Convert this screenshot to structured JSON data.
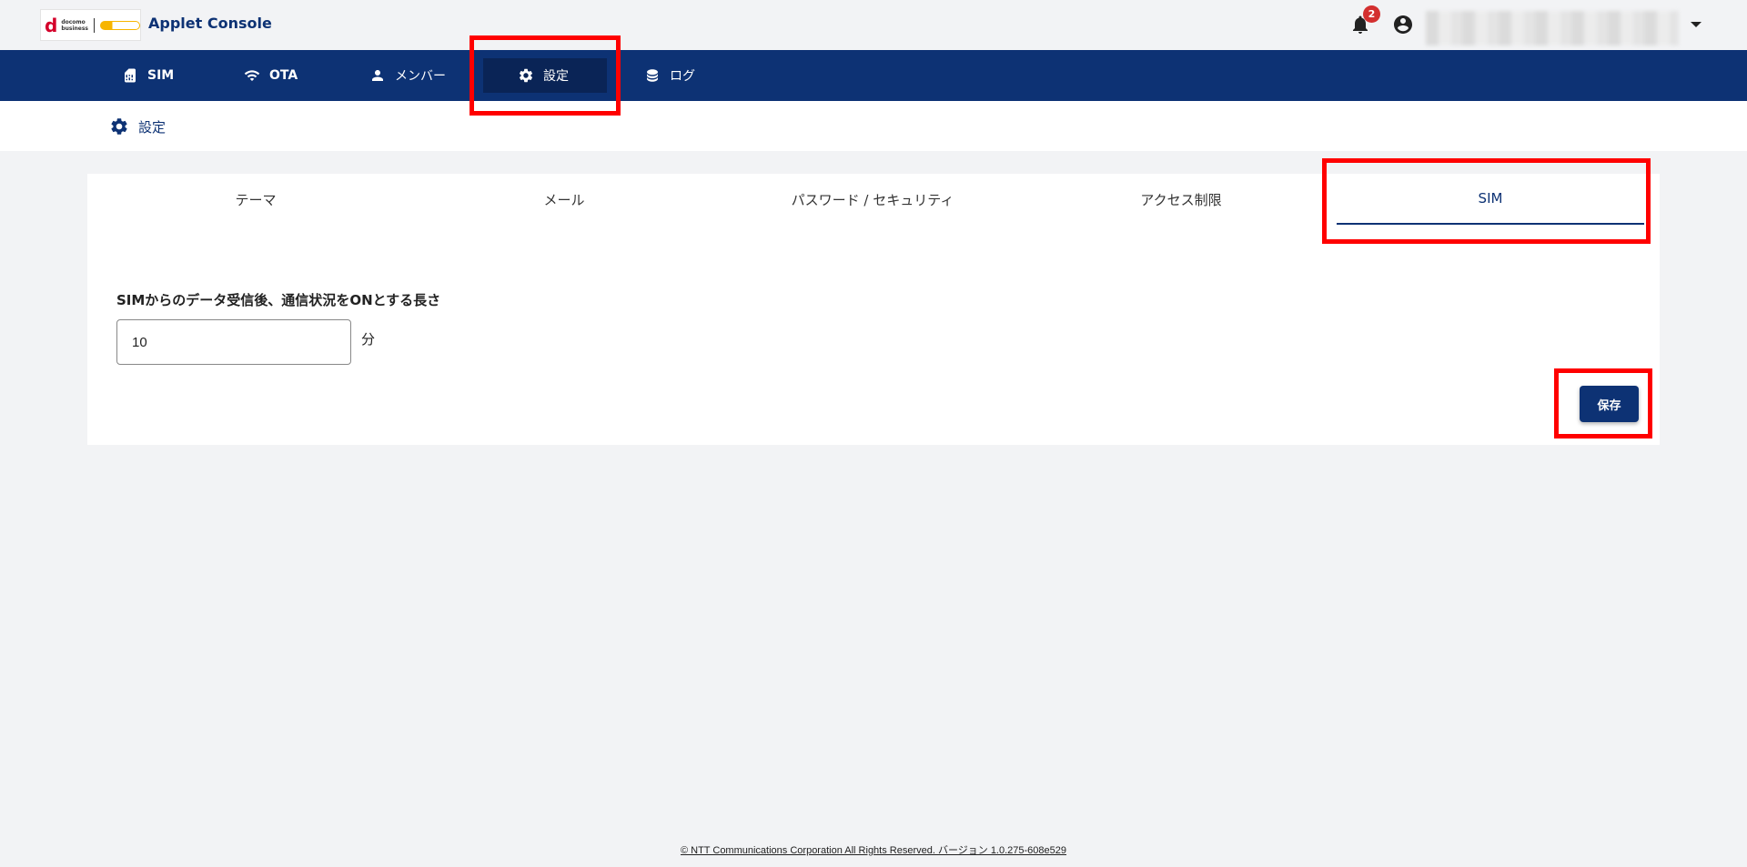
{
  "header": {
    "logo_text_1": "docomo",
    "logo_text_2": "business",
    "title": "Applet Console",
    "notification_count": "2"
  },
  "nav": {
    "items": [
      {
        "label": "SIM",
        "icon": "sim-card-icon"
      },
      {
        "label": "OTA",
        "icon": "wifi-icon"
      },
      {
        "label": "メンバー",
        "icon": "person-icon"
      },
      {
        "label": "設定",
        "icon": "gear-icon",
        "active": true
      },
      {
        "label": "ログ",
        "icon": "database-icon"
      }
    ]
  },
  "breadcrumb": {
    "label": "設定"
  },
  "tabs": [
    {
      "label": "テーマ"
    },
    {
      "label": "メール"
    },
    {
      "label": "パスワード / セキュリティ"
    },
    {
      "label": "アクセス制限"
    },
    {
      "label": "SIM",
      "active": true
    }
  ],
  "form": {
    "label": "SIMからのデータ受信後、通信状況をONとする長さ",
    "value": "10",
    "unit": "分",
    "save_label": "保存"
  },
  "footer": {
    "text": "© NTT Communications Corporation All Rights Reserved. バージョン 1.0.275-608e529"
  },
  "colors": {
    "primary": "#0d3274",
    "highlight": "#ff0000",
    "badge": "#d32f2f"
  }
}
